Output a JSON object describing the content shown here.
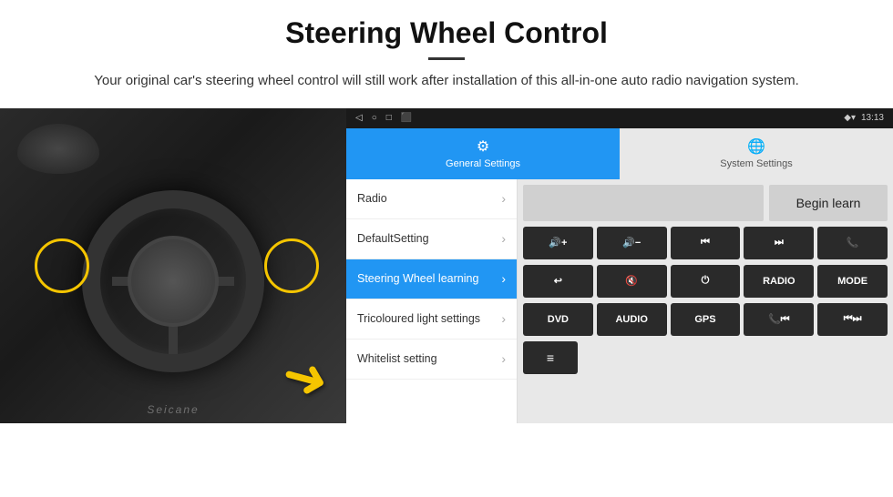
{
  "header": {
    "title": "Steering Wheel Control",
    "subtitle": "Your original car's steering wheel control will still work after installation of this all-in-one auto radio navigation system."
  },
  "status_bar": {
    "left_icons": [
      "◁",
      "○",
      "□",
      "⬛"
    ],
    "right_time": "13:13",
    "right_icons": [
      "◆",
      "▾"
    ]
  },
  "tabs": [
    {
      "id": "general",
      "label": "General Settings",
      "active": true
    },
    {
      "id": "system",
      "label": "System Settings",
      "active": false
    }
  ],
  "menu_items": [
    {
      "label": "Radio",
      "active": false
    },
    {
      "label": "DefaultSetting",
      "active": false
    },
    {
      "label": "Steering Wheel learning",
      "active": true
    },
    {
      "label": "Tricoloured light settings",
      "active": false
    },
    {
      "label": "Whitelist setting",
      "active": false
    }
  ],
  "right_panel": {
    "begin_learn_label": "Begin learn",
    "button_rows": [
      [
        "🔊+",
        "🔊-",
        "⏮",
        "⏭",
        "📞"
      ],
      [
        "↩",
        "🔊✕",
        "⏻",
        "RADIO",
        "MODE"
      ],
      [
        "DVD",
        "AUDIO",
        "GPS",
        "📞⏮",
        "⏮⏭"
      ]
    ],
    "last_row_icon": "≡"
  },
  "watermark": "Seicane"
}
